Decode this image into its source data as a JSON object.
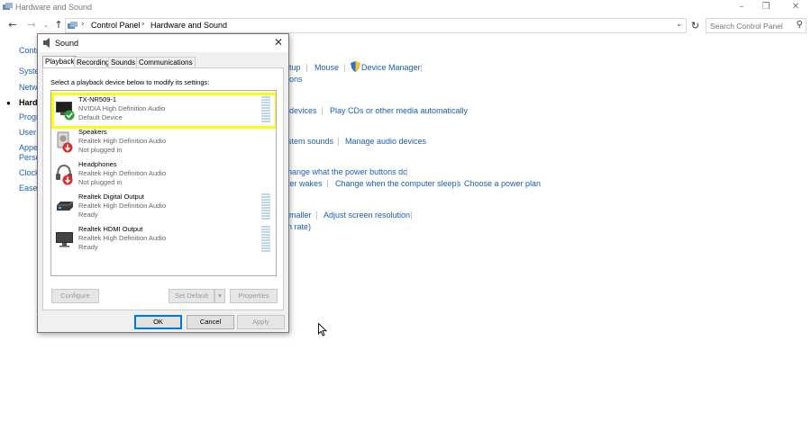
{
  "window": {
    "title": "Hardware and Sound",
    "breadcrumb": [
      "Control Panel",
      "Hardware and Sound"
    ],
    "search_placeholder": "Search Control Panel"
  },
  "sidebar": {
    "items": [
      {
        "label": "Contr",
        "current": false
      },
      {
        "label": "Syste",
        "current": false
      },
      {
        "label": "Netw",
        "current": false
      },
      {
        "label": "Hardw",
        "current": true
      },
      {
        "label": "Progr",
        "current": false
      },
      {
        "label": "User a",
        "current": false
      },
      {
        "label": "Appe",
        "current": false
      },
      {
        "label": "Perso",
        "current": false
      },
      {
        "label": "Clock",
        "current": false
      },
      {
        "label": "Ease o",
        "current": false
      }
    ]
  },
  "main_links": {
    "row1": [
      "tup",
      "Mouse",
      "Device Manager"
    ],
    "row1b": "ons",
    "row2": [
      "devices",
      "Play CDs or other media automatically"
    ],
    "row3": [
      "stem sounds",
      "Manage audio devices"
    ],
    "row4": "hange what the power buttons do",
    "row5": [
      "ter wakes",
      "Change when the computer sleeps",
      "Choose a power plan"
    ],
    "row6": [
      "maller",
      "Adjust screen resolution"
    ],
    "row6b": "h rate)"
  },
  "dialog": {
    "title": "Sound",
    "tabs": [
      "Playback",
      "Recording",
      "Sounds",
      "Communications"
    ],
    "active_tab": "Playback",
    "instruction": "Select a playback device below to modify its settings:",
    "devices": [
      {
        "name": "TX-NR509-1",
        "driver": "NVIDIA High Definition Audio",
        "status": "Default Device",
        "icon": "receiver-icon",
        "badge": "green-check"
      },
      {
        "name": "Speakers",
        "driver": "Realtek High Definition Audio",
        "status": "Not plugged in",
        "icon": "speaker-icon",
        "badge": "red-arrow"
      },
      {
        "name": "Headphones",
        "driver": "Realtek High Definition Audio",
        "status": "Not plugged in",
        "icon": "headphones-icon",
        "badge": "red-arrow"
      },
      {
        "name": "Realtek Digital Output",
        "driver": "Realtek High Definition Audio",
        "status": "Ready",
        "icon": "digital-output-icon",
        "badge": ""
      },
      {
        "name": "Realtek HDMI Output",
        "driver": "Realtek High Definition Audio",
        "status": "Ready",
        "icon": "monitor-icon",
        "badge": ""
      }
    ],
    "buttons": {
      "configure": "Configure",
      "set_default": "Set Default",
      "properties": "Properties",
      "ok": "OK",
      "cancel": "Cancel",
      "apply": "Apply"
    }
  },
  "colors": {
    "link": "#1a5fb4",
    "highlight": "#ffff00",
    "default_button_border": "#0078d7"
  }
}
